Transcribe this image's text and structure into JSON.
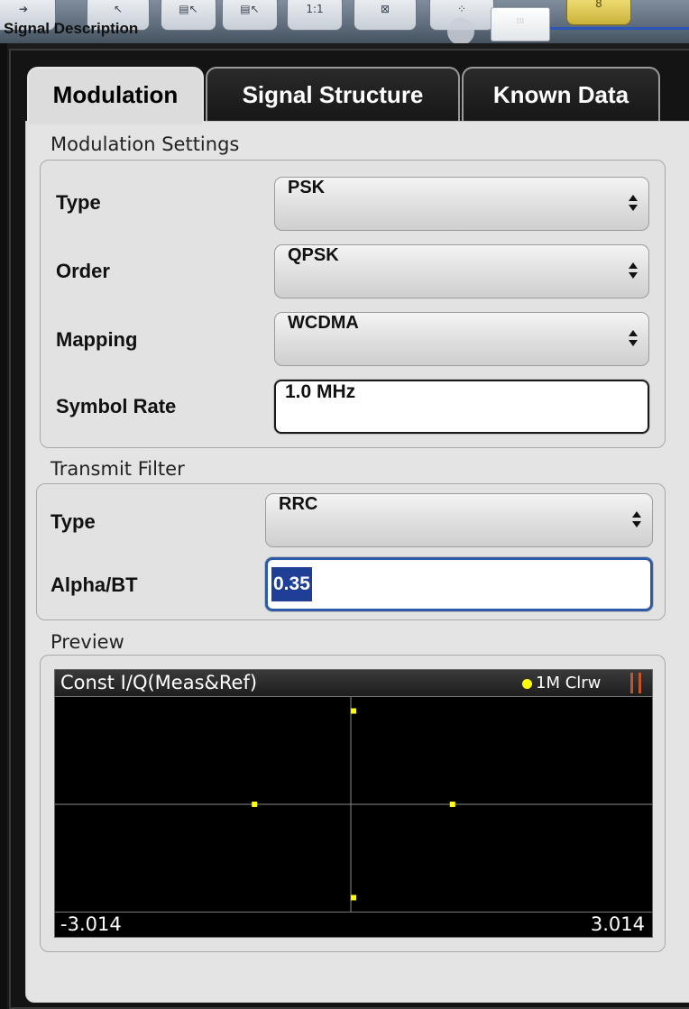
{
  "window": {
    "title": "Signal Description"
  },
  "toolbar": {
    "zoom_label": "1:1"
  },
  "tabs": [
    {
      "label": "Modulation",
      "active": true
    },
    {
      "label": "Signal Structure",
      "active": false
    },
    {
      "label": "Known Data",
      "active": false
    }
  ],
  "modulation_settings": {
    "title": "Modulation Settings",
    "type": {
      "label": "Type",
      "value": "PSK"
    },
    "order": {
      "label": "Order",
      "value": "QPSK"
    },
    "mapping": {
      "label": "Mapping",
      "value": "WCDMA"
    },
    "symbol_rate": {
      "label": "Symbol Rate",
      "value": "1.0 MHz"
    }
  },
  "transmit_filter": {
    "title": "Transmit Filter",
    "type": {
      "label": "Type",
      "value": "RRC"
    },
    "alpha_bt": {
      "label": "Alpha/BT",
      "value": "0.35"
    }
  },
  "preview": {
    "title": "Preview",
    "graph_title": "Const I/Q(Meas&Ref)",
    "trace_label": "1M Clrw",
    "trace_color": "#ffff00",
    "x_min_label": "-3.014",
    "x_max_label": "3.014"
  },
  "chart_data": {
    "type": "scatter",
    "title": "Const I/Q(Meas&Ref)",
    "xlim": [
      -3.014,
      3.014
    ],
    "ylim": [
      -1.15,
      1.15
    ],
    "points": [
      {
        "x": 0.0,
        "y": 1.0
      },
      {
        "x": -1.0,
        "y": 0.0
      },
      {
        "x": 1.0,
        "y": 0.0
      },
      {
        "x": 0.0,
        "y": -1.0
      }
    ],
    "grid": false,
    "legend": "top-right"
  }
}
